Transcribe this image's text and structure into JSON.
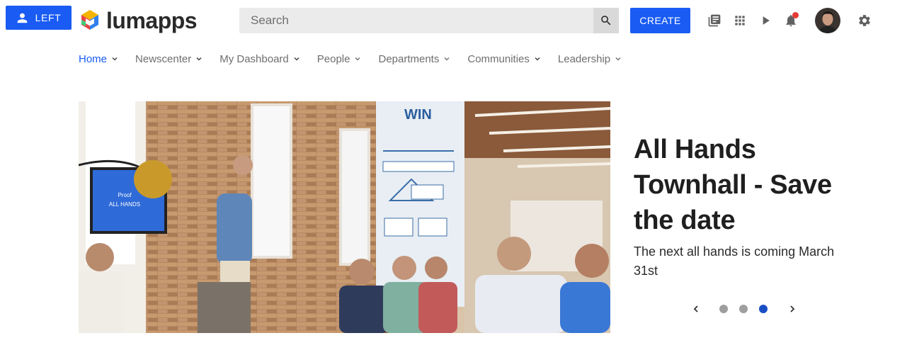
{
  "header": {
    "left_button_label": "LEFT",
    "logo_text": "lumapps",
    "search_placeholder": "Search",
    "create_label": "CREATE",
    "icons": [
      "library-icon",
      "apps-grid-icon",
      "play-icon",
      "bell-icon",
      "settings-icon"
    ],
    "has_notification": true,
    "accent_color": "#1a5cf3",
    "notification_color": "#e53935"
  },
  "nav": {
    "items": [
      {
        "label": "Home",
        "active": true
      },
      {
        "label": "Newscenter",
        "active": false
      },
      {
        "label": "My Dashboard",
        "active": false
      },
      {
        "label": "People",
        "active": false
      },
      {
        "label": "Departments",
        "active": false
      },
      {
        "label": "Communities",
        "active": false
      },
      {
        "label": "Leadership",
        "active": false
      }
    ]
  },
  "hero": {
    "title": "All Hands Townhall - Save the date",
    "subtitle": "The next all hands is coming March 31st",
    "image_description": "office-presentation-photo",
    "slide_count": 3,
    "active_slide": 3
  }
}
